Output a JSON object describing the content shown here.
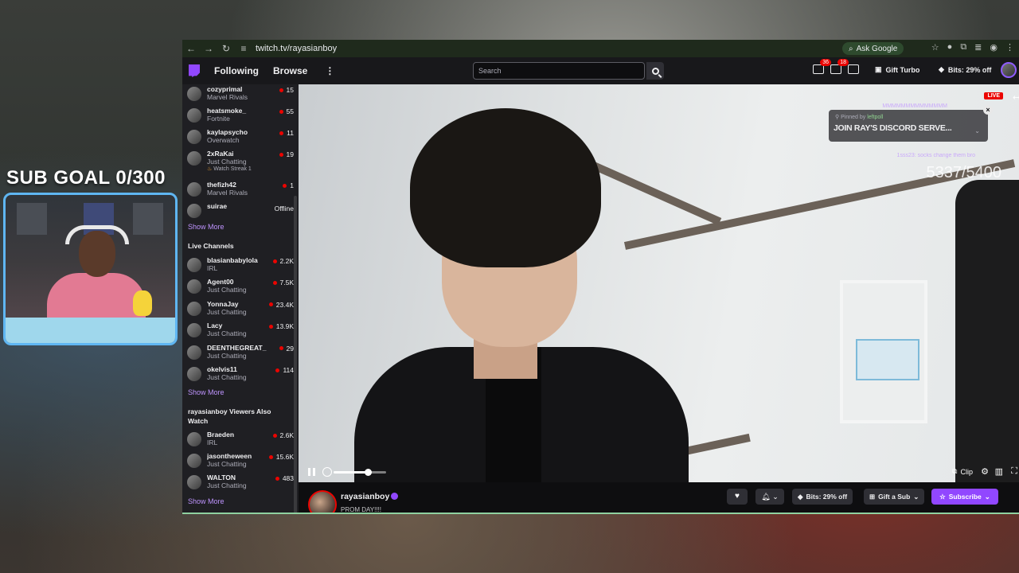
{
  "overlay": {
    "sub_goal": "SUB GOAL 0/300",
    "goal_counter": "5337/5400"
  },
  "browser": {
    "url": "twitch.tv/rayasianboy",
    "ask_google": "Ask Google"
  },
  "topnav": {
    "following": "Following",
    "browse": "Browse",
    "more": "⋮",
    "search_placeholder": "Search",
    "inbox_count": "36",
    "whispers_count": "18",
    "gift_turbo": "Gift Turbo",
    "bits": "Bits: 29% off"
  },
  "sidebar": {
    "followed": [
      {
        "name": "cozyprimal",
        "category": "Marvel Rivals",
        "viewers": "15",
        "extra": ""
      },
      {
        "name": "heatsmoke_",
        "category": "Fortnite",
        "viewers": "55",
        "extra": ""
      },
      {
        "name": "kaylapsycho",
        "category": "Overwatch",
        "viewers": "11",
        "extra": ""
      },
      {
        "name": "2xRaKai",
        "category": "Just Chatting",
        "viewers": "19",
        "extra": "Watch Streak 1"
      },
      {
        "name": "thefizh42",
        "category": "Marvel Rivals",
        "viewers": "1",
        "extra": ""
      }
    ],
    "offline": {
      "name": "suirae",
      "status": "Offline"
    },
    "show_more_1": "Show More",
    "live_heading": "Live Channels",
    "live": [
      {
        "name": "blasianbabylola",
        "category": "IRL",
        "viewers": "2.2K"
      },
      {
        "name": "Agent00",
        "category": "Just Chatting",
        "viewers": "7.5K"
      },
      {
        "name": "YonnaJay",
        "category": "Just Chatting",
        "viewers": "23.4K"
      },
      {
        "name": "Lacy",
        "category": "Just Chatting",
        "viewers": "13.9K"
      },
      {
        "name": "DEENTHEGREAT_",
        "category": "Just Chatting",
        "viewers": "29"
      },
      {
        "name": "okelvis11",
        "category": "Just Chatting",
        "viewers": "114"
      }
    ],
    "show_more_2": "Show More",
    "also_heading": "rayasianboy Viewers Also Watch",
    "also": [
      {
        "name": "Braeden",
        "category": "IRL",
        "viewers": "2.6K"
      },
      {
        "name": "jasontheween",
        "category": "Just Chatting",
        "viewers": "15.6K"
      },
      {
        "name": "WALTON",
        "category": "Just Chatting",
        "viewers": "483"
      }
    ],
    "show_more_3": "Show More"
  },
  "player": {
    "live": "LIVE",
    "pinned_label_prefix": "Pinned by",
    "pinned_by": "leftpoll",
    "pinned_text": "JOIN RAY'S DISCORD SERVE...",
    "chat_lines": [
      "MMMMMMMMMMMMMM",
      "1sss23: socks change them bro"
    ],
    "clip": "Clip",
    "volume_level": 0.65
  },
  "channel": {
    "name": "rayasianboy",
    "title": "PROM DAY!!!!",
    "bits": "Bits: 29% off",
    "gift_sub": "Gift a Sub",
    "subscribe": "Subscribe"
  },
  "colors": {
    "twitch_purple": "#9147ff",
    "live_red": "#eb0400",
    "webcam_border": "#5fb6f2"
  }
}
